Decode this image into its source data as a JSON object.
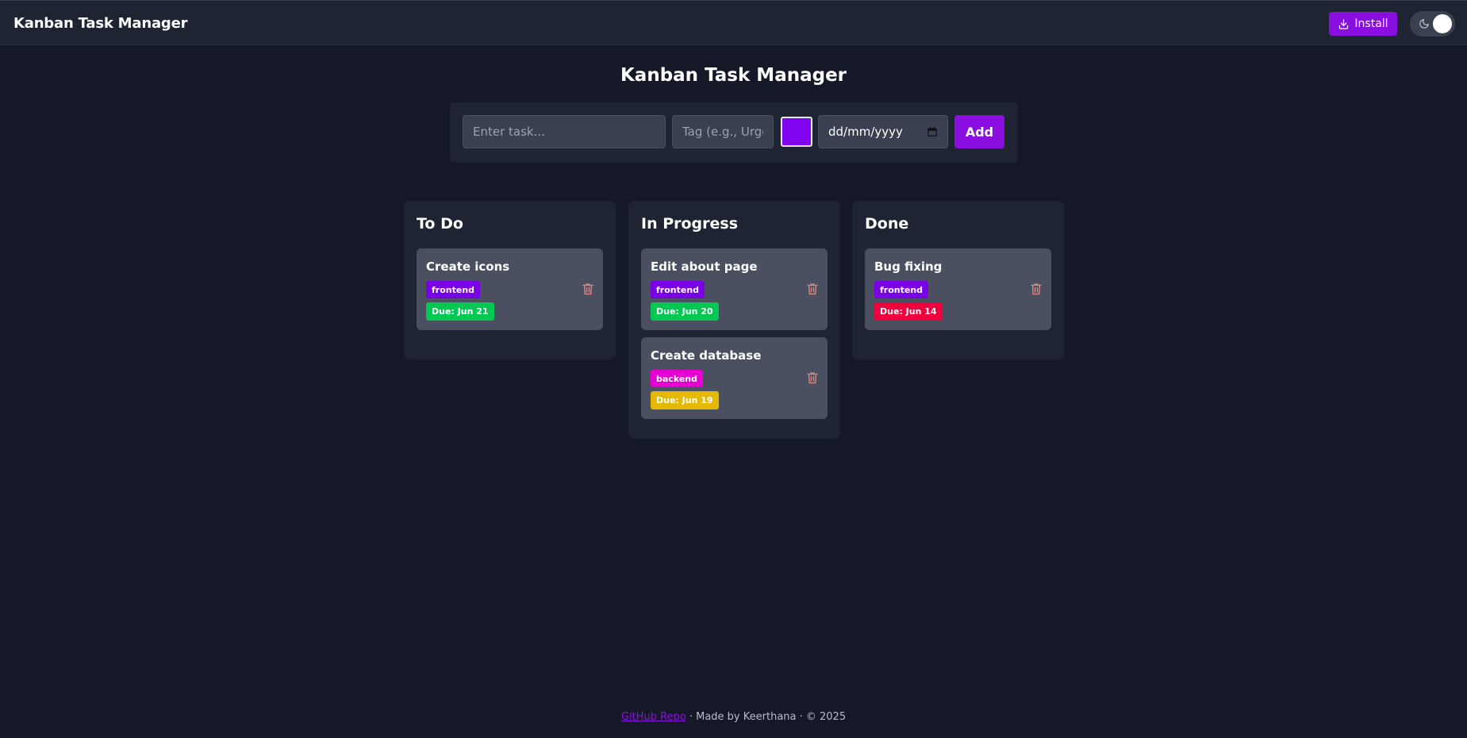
{
  "header": {
    "app_title": "Kanban Task Manager",
    "install_label": "Install",
    "accent_color": "#8b0ee0"
  },
  "main": {
    "title": "Kanban Task Manager",
    "form": {
      "task_placeholder": "Enter task...",
      "tag_placeholder": "Tag (e.g., Urgent)",
      "selected_color": "#8005ee",
      "date_placeholder": "dd/mm/yyyy",
      "add_label": "Add"
    },
    "columns": [
      {
        "title": "To Do",
        "cards": [
          {
            "title": "Create icons",
            "tag": "frontend",
            "tag_color": "#7a00e6",
            "due": "Due: Jun 21",
            "due_color": "#00c853"
          }
        ]
      },
      {
        "title": "In Progress",
        "cards": [
          {
            "title": "Edit about page",
            "tag": "frontend",
            "tag_color": "#7a00e6",
            "due": "Due: Jun 20",
            "due_color": "#00c853"
          },
          {
            "title": "Create database",
            "tag": "backend",
            "tag_color": "#e600d4",
            "due": "Due: Jun 19",
            "due_color": "#e6b800"
          }
        ]
      },
      {
        "title": "Done",
        "cards": [
          {
            "title": "Bug fixing",
            "tag": "frontend",
            "tag_color": "#7a00e6",
            "due": "Due: Jun 14",
            "due_color": "#f0003c"
          }
        ]
      }
    ]
  },
  "footer": {
    "link_label": "GitHub Repo",
    "text": " · Made by Keerthana · © 2025"
  }
}
